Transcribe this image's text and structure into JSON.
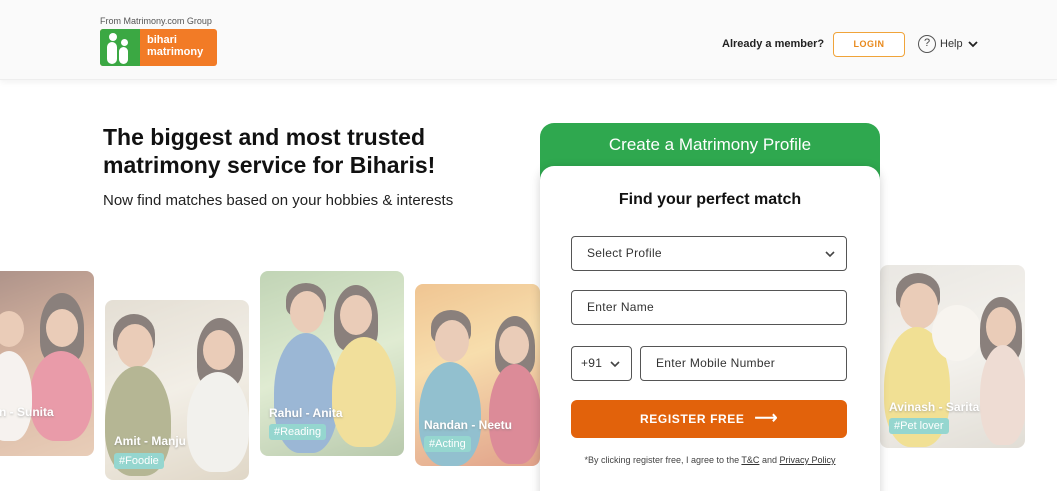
{
  "header": {
    "group_tag": "From Matrimony.com Group",
    "logo_line1": "bihari",
    "logo_line2": "matrimony",
    "already_member": "Already a member?",
    "login_label": "LOGIN",
    "help_label": "Help",
    "help_icon": "?"
  },
  "hero": {
    "title": "The biggest and most trusted matrimony service for Biharis!",
    "subtitle": "Now find matches based on your hobbies & interests"
  },
  "cards": [
    {
      "name": "n - Sunita",
      "tag": ""
    },
    {
      "name": "Amit - Manju",
      "tag": "#Foodie"
    },
    {
      "name": "Rahul - Anita",
      "tag": "#Reading"
    },
    {
      "name": "Nandan - Neetu",
      "tag": "#Acting"
    },
    {
      "name": "Avinash - Sarita",
      "tag": "#Pet lover"
    }
  ],
  "form": {
    "header_title": "Create a Matrimony Profile",
    "title": "Find your perfect match",
    "profile_select": "Select Profile",
    "name_placeholder": "Enter Name",
    "country_code": "+91",
    "mobile_placeholder": "Enter Mobile Number",
    "register_label": "REGISTER FREE",
    "register_arrow": "⟶",
    "terms_prefix": "*By clicking register free, I agree to the",
    "terms_link": "T&C",
    "terms_and": "and",
    "privacy_link": "Privacy Policy"
  },
  "colors": {
    "brand_green": "#2fa84f",
    "brand_orange": "#e2620b",
    "login_border": "#f0a43a",
    "tag_teal": "#3fb6a8"
  }
}
